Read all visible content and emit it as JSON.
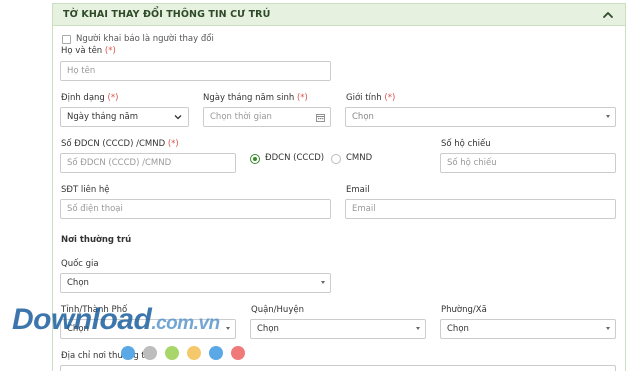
{
  "form": {
    "title": "TỜ KHAI THAY ĐỔI THÔNG TIN CƯ TRÚ",
    "declarer_checkbox_label": "Người khai báo là người thay đổi",
    "full_name": {
      "label": "Họ và tên",
      "required": "(*)",
      "placeholder": "Họ tên"
    },
    "id_format": {
      "label": "Định dạng",
      "required": "(*)",
      "value": "Ngày tháng năm"
    },
    "birth_date": {
      "label": "Ngày tháng năm sinh",
      "required": "(*)",
      "placeholder": "Chọn thời gian"
    },
    "gender": {
      "label": "Giới tính",
      "required": "(*)",
      "value": "Chọn"
    },
    "id_number": {
      "label": "Số ĐDCN (CCCD) /CMND",
      "required": "(*)",
      "placeholder": "Số ĐDCN (CCCD) /CMND"
    },
    "id_type": {
      "option_1": "ĐDCN (CCCD)",
      "option_2": "CMND"
    },
    "passport": {
      "label": "Số hộ chiếu",
      "placeholder": "Số hộ chiếu"
    },
    "phone": {
      "label": "SĐT liên hệ",
      "placeholder": "Số điện thoại"
    },
    "email": {
      "label": "Email",
      "placeholder": "Email"
    },
    "permanent_residence_heading": "Nơi thường trú",
    "country": {
      "label": "Quốc gia",
      "value": "Chọn"
    },
    "province": {
      "label": "Tỉnh/Thành Phố",
      "value": "Chọn"
    },
    "district": {
      "label": "Quận/Huyện",
      "value": "Chọn"
    },
    "ward": {
      "label": "Phường/Xã",
      "value": "Chọn"
    },
    "address": {
      "label": "Địa chỉ nơi thường trú"
    }
  },
  "watermark": {
    "main": "Download",
    "suffix": ".com.vn"
  },
  "colors": {
    "header_bg": "#e6f2df",
    "accent_green": "#3a8a2e",
    "required_red": "#d9534f",
    "dots": [
      "#5aa9e6",
      "#bdbdbd",
      "#a8d66b",
      "#f5c96b",
      "#5aa9e6",
      "#f07a7a"
    ]
  }
}
